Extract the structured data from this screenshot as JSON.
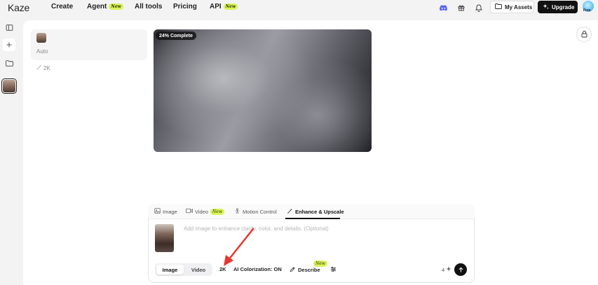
{
  "brand": {
    "logo": "Kaze"
  },
  "nav": {
    "items": [
      {
        "label": "Create",
        "badge": ""
      },
      {
        "label": "Agent",
        "badge": "New"
      },
      {
        "label": "All tools",
        "badge": ""
      },
      {
        "label": "Pricing",
        "badge": ""
      },
      {
        "label": "API",
        "badge": "New"
      }
    ]
  },
  "header": {
    "icons": [
      "discord-icon",
      "gift-icon",
      "bell-icon"
    ],
    "assets_label": "My Assets",
    "upgrade_label": "Upgrade",
    "plan": "Free"
  },
  "rail": {
    "icons": [
      "sidebar-toggle-icon",
      "plus-icon",
      "folder-icon"
    ]
  },
  "settings": {
    "mode": "Auto",
    "resolution": "2K"
  },
  "preview": {
    "progress_label": "24% Complete",
    "progress": 0.24
  },
  "composer": {
    "tabs": [
      {
        "label": "Image",
        "badge": "",
        "icon": "image-icon",
        "active": false
      },
      {
        "label": "Video",
        "badge": "New",
        "icon": "video-icon",
        "active": false
      },
      {
        "label": "Motion Control",
        "badge": "",
        "icon": "motion-icon",
        "active": false
      },
      {
        "label": "Enhance & Upscale",
        "badge": "",
        "icon": "magic-wand-icon",
        "active": true
      }
    ],
    "placeholder": "Add image to enhance clarity, color, and details. (Optional)",
    "type_toggle": {
      "image": "Image",
      "video": "Video",
      "selected": "Image"
    },
    "resolution": "2K",
    "colorization": "AI Colorization: ON",
    "describe_label": "Describe",
    "describe_badge": "New",
    "count": "4"
  },
  "colors": {
    "accent_new_badge": "#d8f35a",
    "annotation_arrow": "#e8352b",
    "primary_button": "#111111"
  }
}
